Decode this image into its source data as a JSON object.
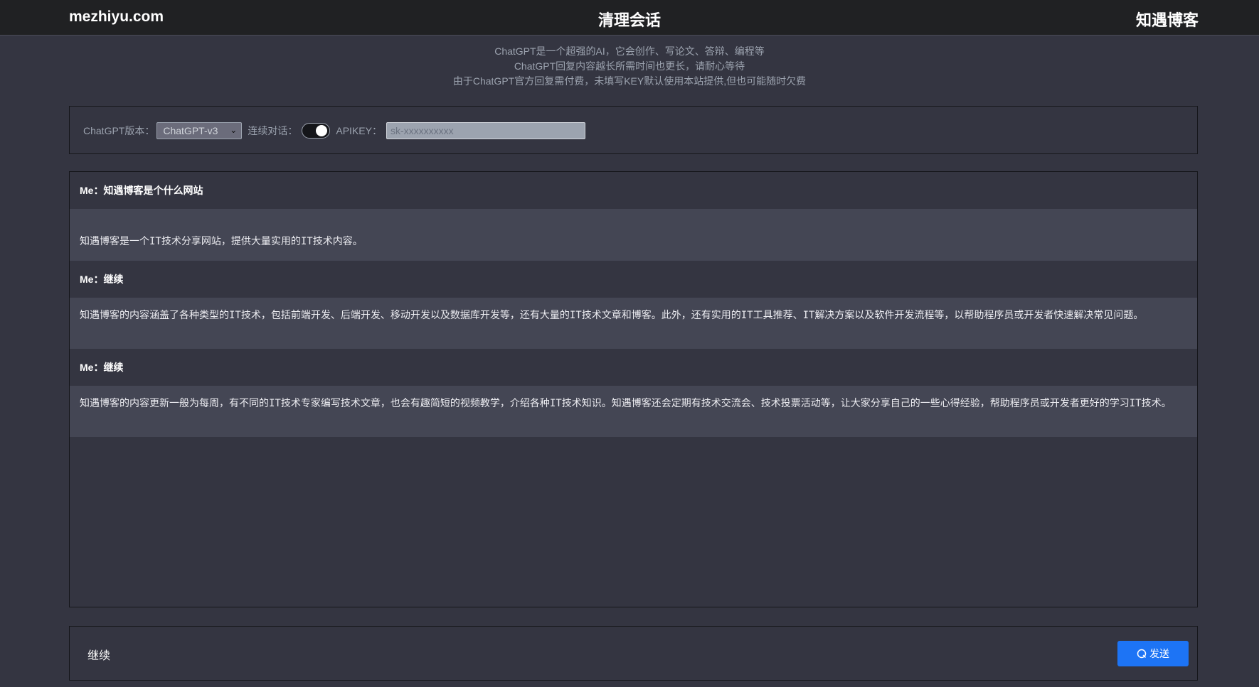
{
  "header": {
    "brand": "mezhiyu.com",
    "clear_label": "清理会话",
    "blog_label": "知遇博客"
  },
  "notice": {
    "line1": "ChatGPT是一个超强的AI，它会创作、写论文、答辩、编程等",
    "line2": "ChatGPT回复内容越长所需时间也更长，请耐心等待",
    "line3": "由于ChatGPT官方回复需付费，未填写KEY默认使用本站提供,但也可能随时欠费"
  },
  "settings": {
    "version_label": "ChatGPT版本：",
    "version_value": "ChatGPT-v3",
    "continuous_label": "连续对话：",
    "continuous_on": true,
    "apikey_label": "APIKEY：",
    "apikey_placeholder": "sk-xxxxxxxxxx"
  },
  "messages": [
    {
      "role": "me",
      "text": "Me：知遇博客是个什么网站"
    },
    {
      "role": "ai",
      "text": "知遇博客是一个IT技术分享网站，提供大量实用的IT技术内容。"
    },
    {
      "role": "me",
      "text": "Me：继续"
    },
    {
      "role": "ai",
      "text": "知遇博客的内容涵盖了各种类型的IT技术，包括前端开发、后端开发、移动开发以及数据库开发等，还有大量的IT技术文章和博客。此外，还有实用的IT工具推荐、IT解决方案以及软件开发流程等，以帮助程序员或开发者快速解决常见问题。"
    },
    {
      "role": "me",
      "text": "Me：继续"
    },
    {
      "role": "ai",
      "text": "知遇博客的内容更新一般为每周，有不同的IT技术专家编写技术文章，也会有趣简短的视频教学，介绍各种IT技术知识。知遇博客还会定期有技术交流会、技术投票活动等，让大家分享自己的一些心得经验，帮助程序员或开发者更好的学习IT技术。"
    }
  ],
  "composer": {
    "input_value": "继续",
    "send_label": "发送"
  },
  "colors": {
    "background": "#343541",
    "topbar": "#202123",
    "ai_row": "#444654",
    "send_button": "#1d74f5"
  }
}
